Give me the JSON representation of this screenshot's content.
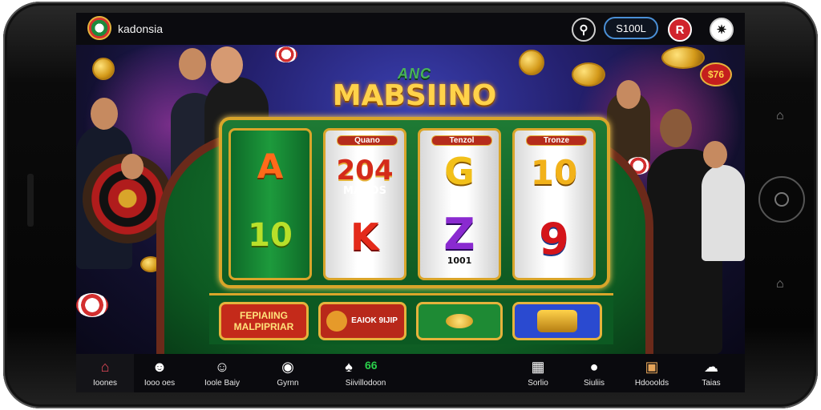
{
  "app": {
    "brand_name": "kadonsia"
  },
  "header": {
    "balance": "S100L",
    "icons": [
      "search-icon",
      "r-badge-icon",
      "settings-icon"
    ],
    "r_badge": "R"
  },
  "game": {
    "title_top": "ANC",
    "title_main": "MABSIINO",
    "reels": [
      {
        "top": "A",
        "bottom": "10"
      },
      {
        "label": "Quano",
        "top": "204",
        "top_sub": "MADDS",
        "bottom": "K"
      },
      {
        "label": "Tenzol",
        "top": "G",
        "bottom": "Z",
        "bottom_sub": "1001"
      },
      {
        "label": "Tronze",
        "top": "10",
        "bottom": "9"
      }
    ],
    "buttons": [
      {
        "label": "FEPIAIING MALPIPRIAR"
      },
      {
        "label": "EAIOK 9IJIP"
      },
      {
        "label": ""
      },
      {
        "label": ""
      }
    ],
    "badge_top_right": "$76"
  },
  "nav": {
    "items": [
      {
        "label": "Ioones",
        "icon": "home-icon"
      },
      {
        "label": "Iooo oes",
        "icon": "dealer-icon"
      },
      {
        "label": "Ioole Baiy",
        "icon": "player-icon"
      },
      {
        "label": "Gyrnn",
        "icon": "chip-icon"
      },
      {
        "label": "Siivillodoon",
        "icon": "cards-icon",
        "extra": "66"
      },
      {
        "label": "Sorlio",
        "icon": "grid-icon"
      },
      {
        "label": "Siuliis",
        "icon": "chat-icon"
      },
      {
        "label": "Hdooolds",
        "icon": "book-icon"
      },
      {
        "label": "Taias",
        "icon": "group-icon"
      }
    ]
  },
  "colors": {
    "accent_gold": "#d9a52a",
    "felt_green": "#1e7a34",
    "balance_border": "#4a8fd6",
    "badge_red": "#d32f2f"
  }
}
